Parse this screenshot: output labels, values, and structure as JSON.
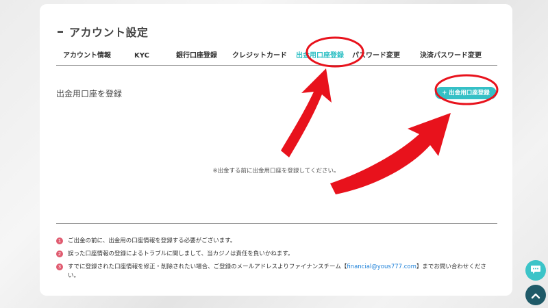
{
  "page": {
    "title": "アカウント設定"
  },
  "tabs": [
    {
      "label": "アカウント情報",
      "active": false
    },
    {
      "label": "KYC",
      "active": false
    },
    {
      "label": "銀行口座登録",
      "active": false
    },
    {
      "label": "クレジットカード",
      "active": false
    },
    {
      "label": "出金用口座登録",
      "active": true
    },
    {
      "label": "パスワード変更",
      "active": false
    },
    {
      "label": "決済パスワード変更",
      "active": false
    }
  ],
  "section": {
    "title": "出金用口座を登録",
    "register_button": "+ 出金用口座登録",
    "empty_message": "※出金する前に出金用口座を登録してください。"
  },
  "notes": [
    {
      "num": "1",
      "text": "ご出金の前に、出金用の口座情報を登録する必要がございます。"
    },
    {
      "num": "2",
      "text": "誤った口座情報の登録によるトラブルに関しまして、当カジノは責任を負いかねます。"
    },
    {
      "num": "3",
      "text_before": "すでに登録された口座情報を修正・削除されたい場合、ご登録のメールアドレスよりファイナンスチーム【",
      "link": "financial@yous777.com",
      "text_after": "】までお問い合わせください。"
    }
  ],
  "icons": {
    "chat": "chat-bubble-icon",
    "scroll_top": "chevron-up-icon"
  },
  "colors": {
    "accent": "#35c0c6",
    "annotation": "#e8121c",
    "note_badge": "#e05a6f",
    "scroll_top_bg": "#1f5a68"
  }
}
